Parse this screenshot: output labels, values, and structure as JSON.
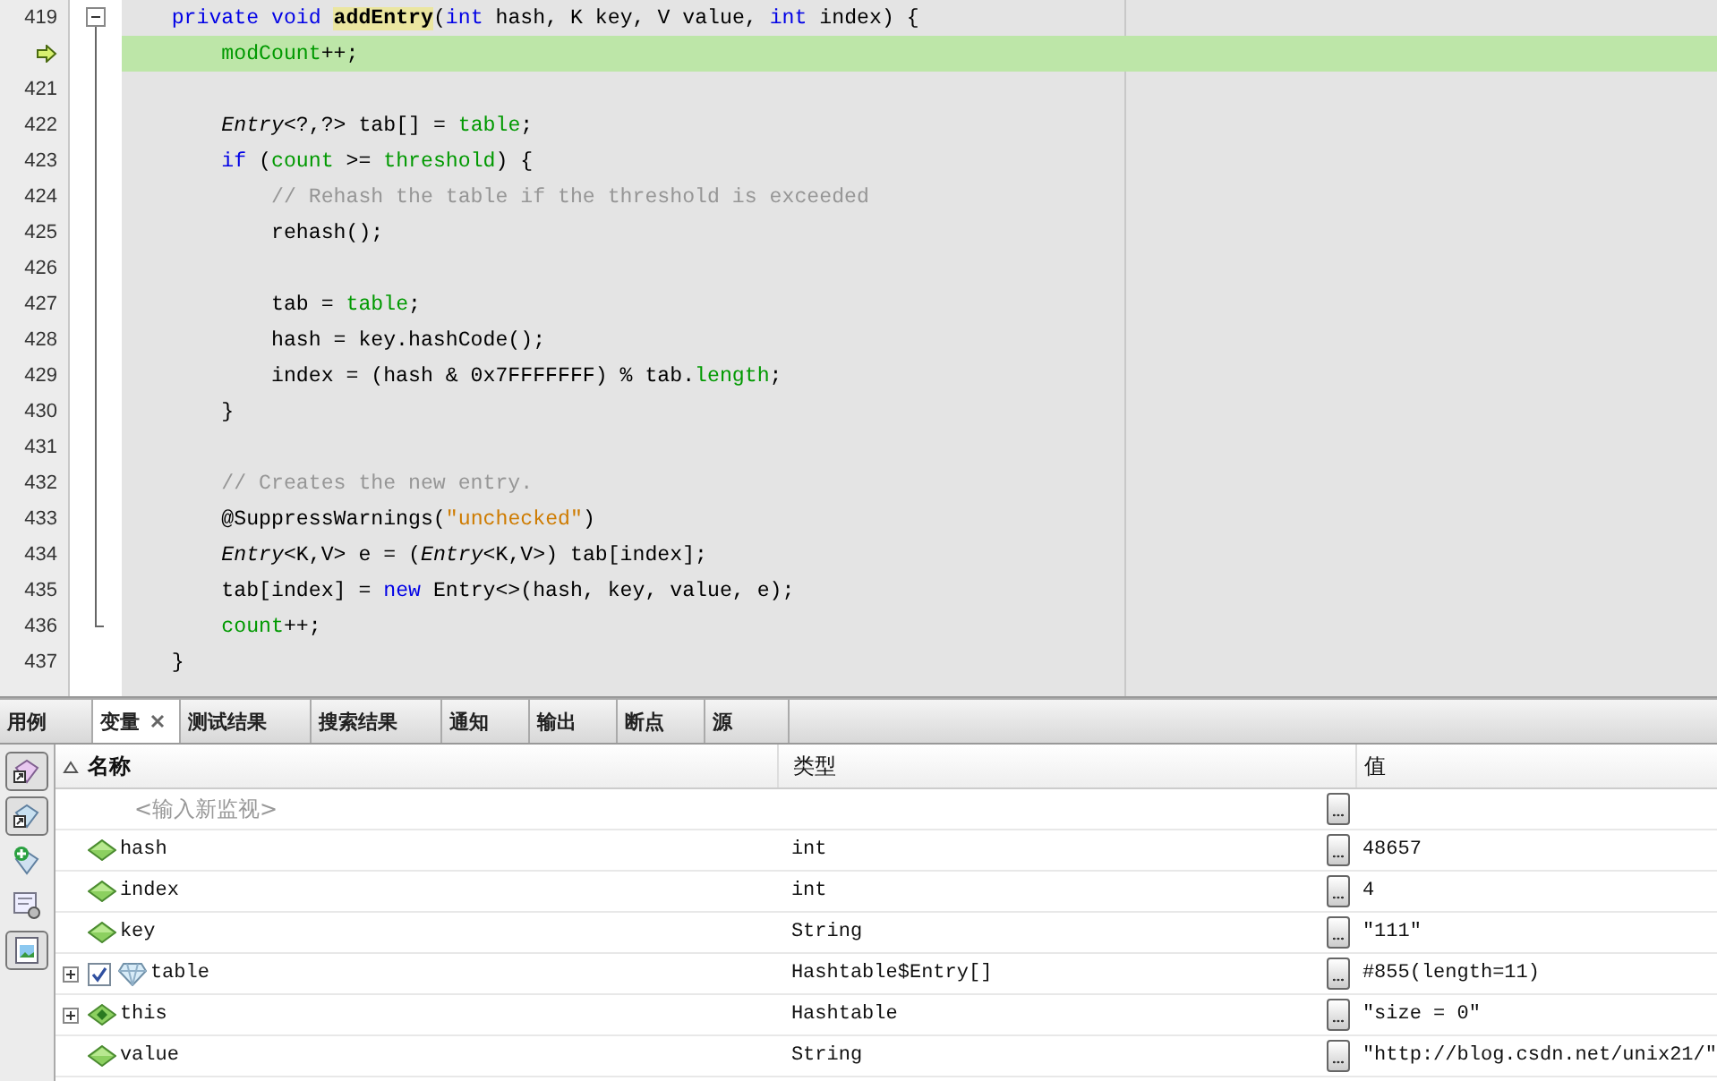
{
  "editor": {
    "lines": [
      {
        "number": "419",
        "current": false,
        "tokens": [
          {
            "t": "    private void ",
            "kind": "keyword"
          },
          {
            "t": "addEntry",
            "kind": "declaration"
          },
          {
            "t": "(",
            "kind": "plain"
          },
          {
            "t": "int",
            "kind": "keyword"
          },
          {
            "t": " hash, K key, V value, ",
            "kind": "plain"
          },
          {
            "t": "int",
            "kind": "keyword"
          },
          {
            "t": " index) {",
            "kind": "plain"
          }
        ]
      },
      {
        "current": true,
        "tokens": [
          {
            "t": "        modCount",
            "kind": "field"
          },
          {
            "t": "++;",
            "kind": "plain"
          }
        ]
      },
      {
        "number": "421",
        "current": false
      },
      {
        "number": "422",
        "current": false,
        "tokens": [
          {
            "t": "        Entry",
            "kind": "type"
          },
          {
            "t": "<?,?> tab[] = ",
            "kind": "plain"
          },
          {
            "t": "table",
            "kind": "field"
          },
          {
            "t": ";",
            "kind": "plain"
          }
        ]
      },
      {
        "number": "423",
        "current": false,
        "tokens": [
          {
            "t": "        if",
            "kind": "keyword"
          },
          {
            "t": " (",
            "kind": "plain"
          },
          {
            "t": "count",
            "kind": "field"
          },
          {
            "t": " >= ",
            "kind": "plain"
          },
          {
            "t": "threshold",
            "kind": "field"
          },
          {
            "t": ") {",
            "kind": "plain"
          }
        ]
      },
      {
        "number": "424",
        "current": false,
        "tokens": [
          {
            "t": "            // Rehash the table if the threshold is exceeded",
            "kind": "comment"
          }
        ]
      },
      {
        "number": "425",
        "current": false,
        "tokens": [
          {
            "t": "            rehash();",
            "kind": "plain"
          }
        ]
      },
      {
        "number": "426",
        "current": false
      },
      {
        "number": "427",
        "current": false,
        "tokens": [
          {
            "t": "            tab = ",
            "kind": "plain"
          },
          {
            "t": "table",
            "kind": "field"
          },
          {
            "t": ";",
            "kind": "plain"
          }
        ]
      },
      {
        "number": "428",
        "current": false,
        "tokens": [
          {
            "t": "            hash = key.hashCode();",
            "kind": "plain"
          }
        ]
      },
      {
        "number": "429",
        "current": false,
        "tokens": [
          {
            "t": "            index = (hash & 0x7FFFFFFF) % tab.",
            "kind": "plain"
          },
          {
            "t": "length",
            "kind": "field"
          },
          {
            "t": ";",
            "kind": "plain"
          }
        ]
      },
      {
        "number": "430",
        "current": false,
        "tokens": [
          {
            "t": "        }",
            "kind": "plain"
          }
        ]
      },
      {
        "number": "431",
        "current": false
      },
      {
        "number": "432",
        "current": false,
        "tokens": [
          {
            "t": "        // Creates the new entry.",
            "kind": "comment"
          }
        ]
      },
      {
        "number": "433",
        "current": false,
        "tokens": [
          {
            "t": "        @SuppressWarnings(",
            "kind": "plain"
          },
          {
            "t": "\"unchecked\"",
            "kind": "string"
          },
          {
            "t": ")",
            "kind": "plain"
          }
        ]
      },
      {
        "number": "434",
        "current": false,
        "tokens": [
          {
            "t": "        Entry",
            "kind": "type"
          },
          {
            "t": "<K,V> e = (",
            "kind": "plain"
          },
          {
            "t": "Entry",
            "kind": "type"
          },
          {
            "t": "<K,V>) tab[index];",
            "kind": "plain"
          }
        ]
      },
      {
        "number": "435",
        "current": false,
        "tokens": [
          {
            "t": "        tab[index] = ",
            "kind": "plain"
          },
          {
            "t": "new",
            "kind": "keyword"
          },
          {
            "t": " Entry<>(hash, key, value, e);",
            "kind": "plain"
          }
        ]
      },
      {
        "number": "436",
        "current": false,
        "tokens": [
          {
            "t": "        count",
            "kind": "field"
          },
          {
            "t": "++;",
            "kind": "plain"
          }
        ]
      },
      {
        "number": "437",
        "current": false,
        "tokens": [
          {
            "t": "    }",
            "kind": "plain"
          }
        ]
      }
    ]
  },
  "tabs": [
    {
      "label": "用例",
      "selected": false
    },
    {
      "label": "变量",
      "selected": true
    },
    {
      "label": "测试结果",
      "selected": false
    },
    {
      "label": "搜索结果",
      "selected": false
    },
    {
      "label": "通知",
      "selected": false
    },
    {
      "label": "输出",
      "selected": false
    },
    {
      "label": "断点",
      "selected": false
    },
    {
      "label": "源",
      "selected": false
    }
  ],
  "table": {
    "columns": [
      "名称",
      "类型",
      "值"
    ],
    "watch": {
      "placeholder": "<输入新监视>"
    },
    "rows": [
      {
        "kind": "local",
        "name": "hash",
        "type": "int",
        "value": "48657"
      },
      {
        "kind": "local",
        "name": "index",
        "type": "int",
        "value": "4"
      },
      {
        "kind": "local",
        "name": "key",
        "type": "String",
        "value": "\"111\""
      },
      {
        "kind": "array",
        "name": "table",
        "type": "Hashtable$Entry[]",
        "value": "#855(length=11)",
        "expanded": false,
        "checked": true
      },
      {
        "kind": "object",
        "name": "this",
        "type": "Hashtable",
        "value": "\"size = 0\"",
        "expanded": false
      },
      {
        "kind": "local",
        "name": "value",
        "type": "String",
        "value": "\"http://blog.csdn.net/unix21/\""
      }
    ]
  }
}
